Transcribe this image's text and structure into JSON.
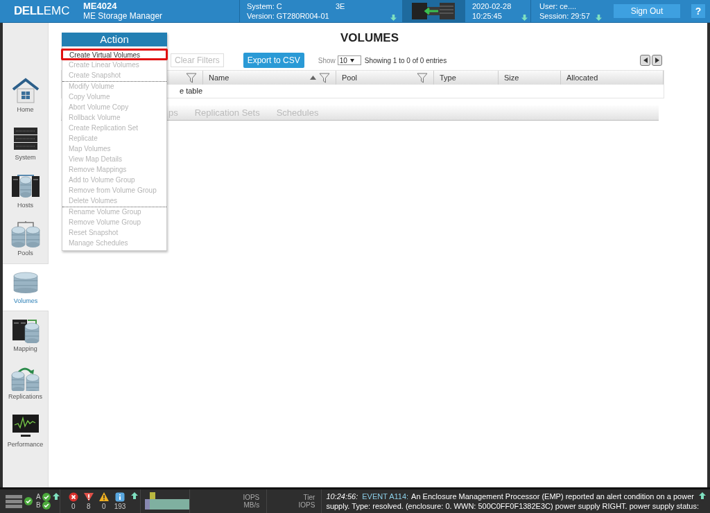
{
  "header": {
    "logo_bold": "DELL",
    "logo_light": "EMC",
    "product": "ME4024",
    "product_subtitle": "ME Storage Manager",
    "system": "System: C",
    "system_tail": "3E",
    "version": "Version: GT280R004-01",
    "date": "2020-02-28",
    "time": "10:25:45",
    "user": "User: ce....",
    "session": "Session: 29:57",
    "sign_out": "Sign Out",
    "help": "?"
  },
  "sidebar": {
    "items": [
      {
        "label": "Home",
        "kind": "home",
        "selected": false
      },
      {
        "label": "System",
        "kind": "system",
        "selected": false
      },
      {
        "label": "Hosts",
        "kind": "hosts",
        "selected": false
      },
      {
        "label": "Pools",
        "kind": "pools",
        "selected": false
      },
      {
        "label": "Volumes",
        "kind": "volumes",
        "selected": true
      },
      {
        "label": "Mapping",
        "kind": "mapping",
        "selected": false
      },
      {
        "label": "Replications",
        "kind": "replications",
        "selected": false
      },
      {
        "label": "Performance",
        "kind": "performance",
        "selected": false
      }
    ]
  },
  "page_title": "VOLUMES",
  "toolbar": {
    "clear_filters": "Clear Filters",
    "export": "Export to CSV",
    "show_label": "Show",
    "page_size": "10",
    "entries": "Showing 1 to 0 of 0 entries"
  },
  "table": {
    "columns": [
      {
        "filter": true,
        "sort": false
      },
      {
        "label": "Name",
        "filter": true,
        "sort": true
      },
      {
        "label": "Pool",
        "filter": true,
        "sort": false
      },
      {
        "label": "Type",
        "filter": false,
        "sort": false
      },
      {
        "label": "Size",
        "filter": false,
        "sort": false
      },
      {
        "label": "Allocated",
        "filter": false,
        "sort": false
      }
    ],
    "empty_text": "e table"
  },
  "tabs": [
    "ps",
    "Replication Sets",
    "Schedules"
  ],
  "action_menu": {
    "title": "Action",
    "groups": [
      [
        {
          "label": "Create Virtual Volumes",
          "disabled": false,
          "highlighted": true
        },
        {
          "label": "Create Linear Volumes",
          "disabled": true,
          "highlighted": false
        },
        {
          "label": "Create Snapshot",
          "disabled": true,
          "highlighted": false
        }
      ],
      [
        {
          "label": "Modify Volume",
          "disabled": true,
          "highlighted": false
        },
        {
          "label": "Copy Volume",
          "disabled": true,
          "highlighted": false
        },
        {
          "label": "Abort Volume Copy",
          "disabled": true,
          "highlighted": false
        },
        {
          "label": "Rollback Volume",
          "disabled": true,
          "highlighted": false
        },
        {
          "label": "Create Replication Set",
          "disabled": true,
          "highlighted": false
        },
        {
          "label": "Replicate",
          "disabled": true,
          "highlighted": false
        },
        {
          "label": "Map Volumes",
          "disabled": true,
          "highlighted": false
        },
        {
          "label": "View Map Details",
          "disabled": true,
          "highlighted": false
        },
        {
          "label": "Remove Mappings",
          "disabled": true,
          "highlighted": false
        },
        {
          "label": "Add to Volume Group",
          "disabled": true,
          "highlighted": false
        },
        {
          "label": "Remove from Volume Group",
          "disabled": true,
          "highlighted": false
        },
        {
          "label": "Delete Volumes",
          "disabled": true,
          "highlighted": false
        }
      ],
      [
        {
          "label": "Rename Volume Group",
          "disabled": true,
          "highlighted": false
        },
        {
          "label": "Remove Volume Group",
          "disabled": true,
          "highlighted": false
        },
        {
          "label": "Reset Snapshot",
          "disabled": true,
          "highlighted": false
        },
        {
          "label": "Manage Schedules",
          "disabled": true,
          "highlighted": false
        }
      ]
    ]
  },
  "status_bar": {
    "controllers": [
      "A",
      "B"
    ],
    "alerts": [
      {
        "kind": "critical",
        "count": "0"
      },
      {
        "kind": "error",
        "count": "8"
      },
      {
        "kind": "warning",
        "count": "0"
      },
      {
        "kind": "info",
        "count": "193"
      }
    ],
    "io_labels": [
      "IOPS",
      "MB/s"
    ],
    "tier_labels": [
      "Tier",
      "IOPS"
    ],
    "event": {
      "time": "10:24:56:",
      "code": "EVENT A114:",
      "line1": "An Enclosure Management Processor (EMP) reported an alert condition on a power",
      "line2": "supply. Type: resolved. (enclosure: 0. WWN: 500C0FF0F1382E3C) power supply RIGHT. power supply status:"
    }
  }
}
